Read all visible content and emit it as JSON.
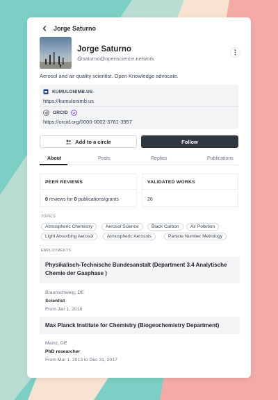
{
  "header": {
    "back_icon": "chevron-left-icon",
    "title": "Jorge Saturno"
  },
  "profile": {
    "name": "Jorge Saturno",
    "handle": "@saturno@openscience.network",
    "bio": "Aerosol and air quality scientist. Open Knowledge advocate.",
    "more_icon": "more-vertical-icon"
  },
  "links": [
    {
      "name": "KUMULONIMB.US",
      "url": "https://kumulonimb.us",
      "icon": "website-icon"
    },
    {
      "name": "ORCID",
      "url": "https://orcid.org/0000-0002-3761-3957",
      "icon": "orcid-icon",
      "verified": true
    }
  ],
  "actions": {
    "add_circle": "Add to a circle",
    "follow": "Follow"
  },
  "tabs": [
    "About",
    "Posts",
    "Replies",
    "Publications"
  ],
  "active_tab": "About",
  "stats": {
    "peer_reviews": {
      "title": "PEER REVIEWS",
      "reviews": "0",
      "mid": " reviews for ",
      "grants": "0",
      "tail": " publications/grants"
    },
    "validated_works": {
      "title": "VALIDATED WORKS",
      "value": "26"
    }
  },
  "topics_label": "TOPICS",
  "topics": [
    "Atmospheric Chemistry",
    "Aerosol Science",
    "Black Carbon",
    "Air Pollution",
    "Light Absorbing Aerosol",
    "Atmospheric Aerosols",
    "Particle Number Metrology"
  ],
  "employments_label": "EMPLOYMENTS",
  "employments": [
    {
      "org": "Physikalisch-Technische Bundesanstalt (Department 3.4 Analytische Chemie der Gasphase )",
      "location": "Braunschweig, DE",
      "role": "Scientist",
      "dates": "From Jan 1, 2018"
    },
    {
      "org": "Max Planck Institute for Chemistry (Biogeochemistry Department)",
      "location": "Mainz, DE",
      "role": "PhD researcher",
      "dates": "From Mar 1, 2013 to Dec 31, 2017"
    }
  ],
  "colors": {
    "primary": "#2f3640",
    "bg_teal": "#7ccfc4",
    "bg_pink": "#f4aaa6",
    "bg_cream": "#f7e2cf",
    "bg_mint": "#b6ddd4"
  }
}
